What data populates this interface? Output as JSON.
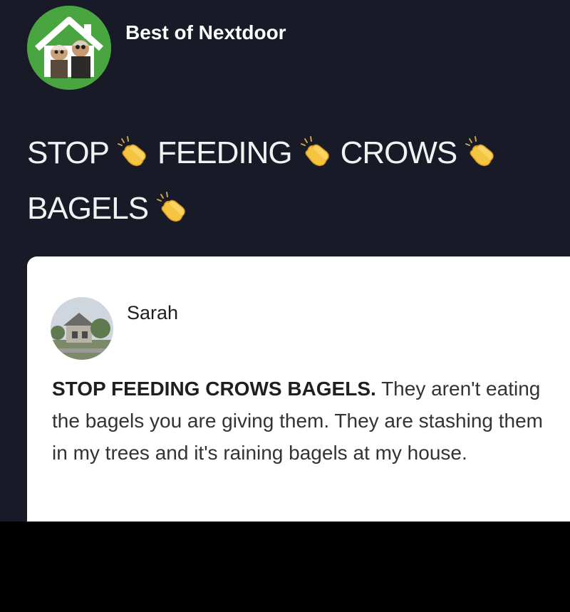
{
  "account": {
    "name": "Best of Nextdoor",
    "avatar_icon": "muppets-house-avatar",
    "brand_color": "#49a53f"
  },
  "headline": {
    "words": [
      "STOP",
      "FEEDING",
      "CROWS",
      "BAGELS"
    ],
    "emoji_icon": "clapping-hands-icon"
  },
  "quoted_post": {
    "author": "Sarah",
    "avatar_icon": "house-photo-avatar",
    "lead_text": "STOP FEEDING CROWS BAGELS.",
    "body_text": " They aren't eating the bagels you are giving them. They are stashing them in my trees and it's raining bagels at my house."
  },
  "colors": {
    "background": "#181b27",
    "card": "#ffffff",
    "text_light": "#f2f2f2"
  }
}
